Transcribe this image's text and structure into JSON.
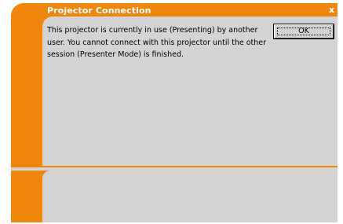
{
  "dialog": {
    "title": "Projector Connection",
    "close_label": "x",
    "message": "This projector is currently in use (Presenting) by another user. You cannot connect with this projector until the other session (Presenter Mode) is finished.",
    "ok_label": "OK"
  },
  "colors": {
    "accent": "#f0860c",
    "panel": "#d4d4d4"
  }
}
